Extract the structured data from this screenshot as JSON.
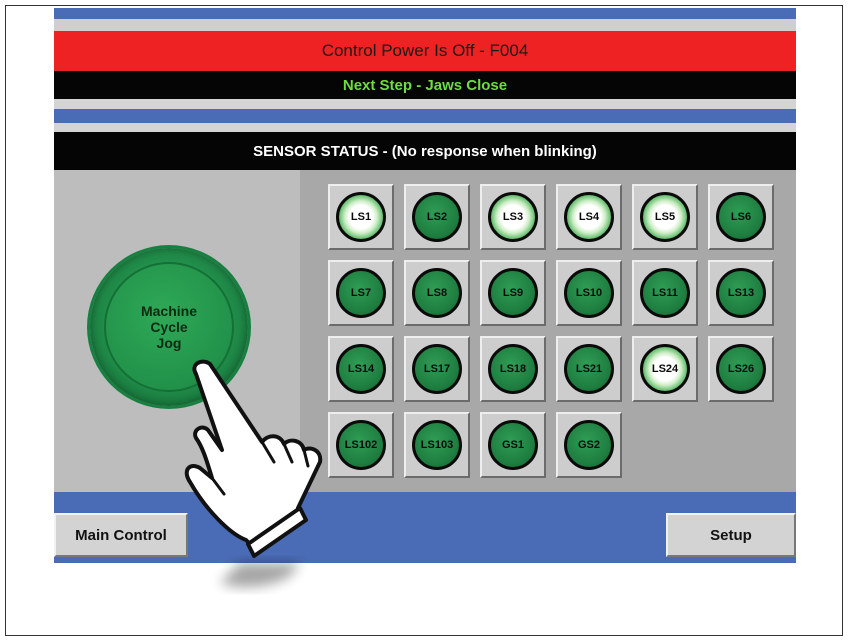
{
  "header": {
    "alarm_text": "Control Power Is Off - F004",
    "next_step_text": "Next Step - Jaws Close"
  },
  "sensor_panel": {
    "title": "SENSOR STATUS - (No response when blinking)"
  },
  "jog_button": {
    "line1": "Machine",
    "line2": "Cycle",
    "line3": "Jog"
  },
  "sensors": [
    {
      "label": "LS1",
      "state": "on"
    },
    {
      "label": "LS2",
      "state": "off"
    },
    {
      "label": "LS3",
      "state": "on"
    },
    {
      "label": "LS4",
      "state": "on"
    },
    {
      "label": "LS5",
      "state": "on"
    },
    {
      "label": "LS6",
      "state": "off"
    },
    {
      "label": "LS7",
      "state": "off"
    },
    {
      "label": "LS8",
      "state": "off"
    },
    {
      "label": "LS9",
      "state": "off"
    },
    {
      "label": "LS10",
      "state": "off"
    },
    {
      "label": "LS11",
      "state": "off"
    },
    {
      "label": "LS13",
      "state": "off"
    },
    {
      "label": "LS14",
      "state": "off"
    },
    {
      "label": "LS17",
      "state": "off"
    },
    {
      "label": "LS18",
      "state": "off"
    },
    {
      "label": "LS21",
      "state": "off"
    },
    {
      "label": "LS24",
      "state": "on"
    },
    {
      "label": "LS26",
      "state": "off"
    },
    {
      "label": "LS102",
      "state": "off"
    },
    {
      "label": "LS103",
      "state": "off"
    },
    {
      "label": "GS1",
      "state": "off"
    },
    {
      "label": "GS2",
      "state": "off"
    }
  ],
  "footer": {
    "main_control_label": "Main Control",
    "setup_label": "Setup"
  },
  "colors": {
    "alarm_red": "#ee2222",
    "step_green_text": "#6fdc3f",
    "strip_blue": "#4a6bb5",
    "led_green": "#1e7d40"
  },
  "icons": {
    "pointer": "hand-pointer-icon"
  }
}
